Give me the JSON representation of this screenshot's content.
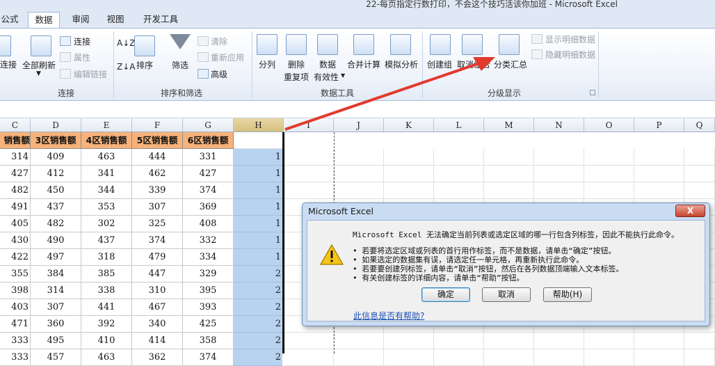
{
  "window": {
    "title": "22-每页指定行数打印，不会这个技巧活该你加班 - Microsoft Excel"
  },
  "tabs": [
    {
      "label": "公式",
      "active": false
    },
    {
      "label": "数据",
      "active": true
    },
    {
      "label": "审阅",
      "active": false
    },
    {
      "label": "视图",
      "active": false
    },
    {
      "label": "开发工具",
      "active": false
    }
  ],
  "ribbon": {
    "connections": {
      "group": "连接",
      "conn_partial": "连接",
      "refresh_all": "全部刷新",
      "connections": "连接",
      "properties": "属性",
      "edit_links": "编辑链接"
    },
    "sort_filter": {
      "group": "排序和筛选",
      "sort": "排序",
      "filter": "筛选",
      "clear": "清除",
      "reapply": "重新应用",
      "advanced": "高级"
    },
    "data_tools": {
      "group": "数据工具",
      "split": "分列",
      "remove_line1": "删除",
      "remove_line2": "重复项",
      "validation_line1": "数据",
      "validation_line2": "有效性",
      "consolidate": "合并计算",
      "what_if": "模拟分析"
    },
    "outline": {
      "group": "分级显示",
      "group_btn": "创建组",
      "ungroup_btn": "取消组合",
      "subtotal": "分类汇总",
      "show_detail": "显示明细数据",
      "hide_detail": "隐藏明细数据"
    }
  },
  "grid": {
    "columns": [
      "C",
      "D",
      "E",
      "F",
      "G",
      "H",
      "I",
      "J",
      "K",
      "L",
      "M",
      "N",
      "O",
      "P",
      "Q"
    ],
    "headers": [
      "销售额",
      "3区销售额",
      "4区销售额",
      "5区销售额",
      "6区销售额"
    ],
    "rows": [
      [
        "314",
        "409",
        "463",
        "444",
        "331",
        "1"
      ],
      [
        "427",
        "412",
        "341",
        "462",
        "427",
        "1"
      ],
      [
        "482",
        "450",
        "344",
        "339",
        "374",
        "1"
      ],
      [
        "491",
        "437",
        "353",
        "307",
        "369",
        "1"
      ],
      [
        "405",
        "482",
        "302",
        "325",
        "408",
        "1"
      ],
      [
        "430",
        "490",
        "437",
        "374",
        "332",
        "1"
      ],
      [
        "422",
        "497",
        "318",
        "479",
        "334",
        "1"
      ],
      [
        "355",
        "384",
        "385",
        "447",
        "329",
        "2"
      ],
      [
        "398",
        "314",
        "338",
        "310",
        "395",
        "2"
      ],
      [
        "403",
        "307",
        "441",
        "467",
        "393",
        "2"
      ],
      [
        "471",
        "360",
        "392",
        "340",
        "425",
        "2"
      ],
      [
        "333",
        "495",
        "410",
        "414",
        "358",
        "2"
      ],
      [
        "333",
        "457",
        "463",
        "362",
        "374",
        "2"
      ]
    ]
  },
  "dialog": {
    "title": "Microsoft Excel",
    "close": "X",
    "message": "Microsoft Excel 无法确定当前列表或选定区域的哪一行包含列标签，因此不能执行此命令。",
    "bullets": [
      "• 若要将选定区域或列表的首行用作标签，而不是数据，请单击“确定”按钮。",
      "• 如果选定的数据集有误，请选定任一单元格，再重新执行此命令。",
      "• 若要要创建列标签，请单击“取消”按钮，然后在各列数据顶端输入文本标签。",
      "• 有关创建标签的详细内容，请单击“帮助”按钮。"
    ],
    "ok": "确定",
    "cancel": "取消",
    "help": "帮助(H)",
    "help_link": "此信息是否有帮助?"
  },
  "colors": {
    "header_fill": "#f6b27a",
    "selected_column": "#b8d3f0",
    "arrow": "#e23a2e",
    "dialog_frame": "#c9dcf2"
  }
}
